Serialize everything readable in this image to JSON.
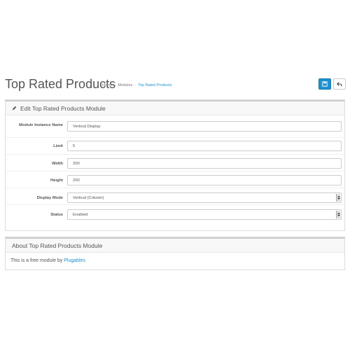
{
  "header": {
    "title": "Top Rated Products",
    "breadcrumb": [
      "Home",
      "Modules",
      "Top Rated Products"
    ],
    "save_icon": "save-icon",
    "back_icon": "reply-icon"
  },
  "edit_panel": {
    "heading": "Edit Top Rated Products Module",
    "fields": {
      "name_label": "Module Instance Name",
      "name_value": "Vertical Display",
      "limit_label": "Limit",
      "limit_value": "5",
      "width_label": "Width",
      "width_value": "200",
      "height_label": "Height",
      "height_value": "200",
      "display_mode_label": "Display Mode",
      "display_mode_value": "Vertical (Column)",
      "status_label": "Status",
      "status_value": "Enabled"
    }
  },
  "about_panel": {
    "heading": "About Top Rated Products Module",
    "text": "This is a free module by",
    "link": "Plugables"
  },
  "colors": {
    "accent": "#1e91cf"
  }
}
